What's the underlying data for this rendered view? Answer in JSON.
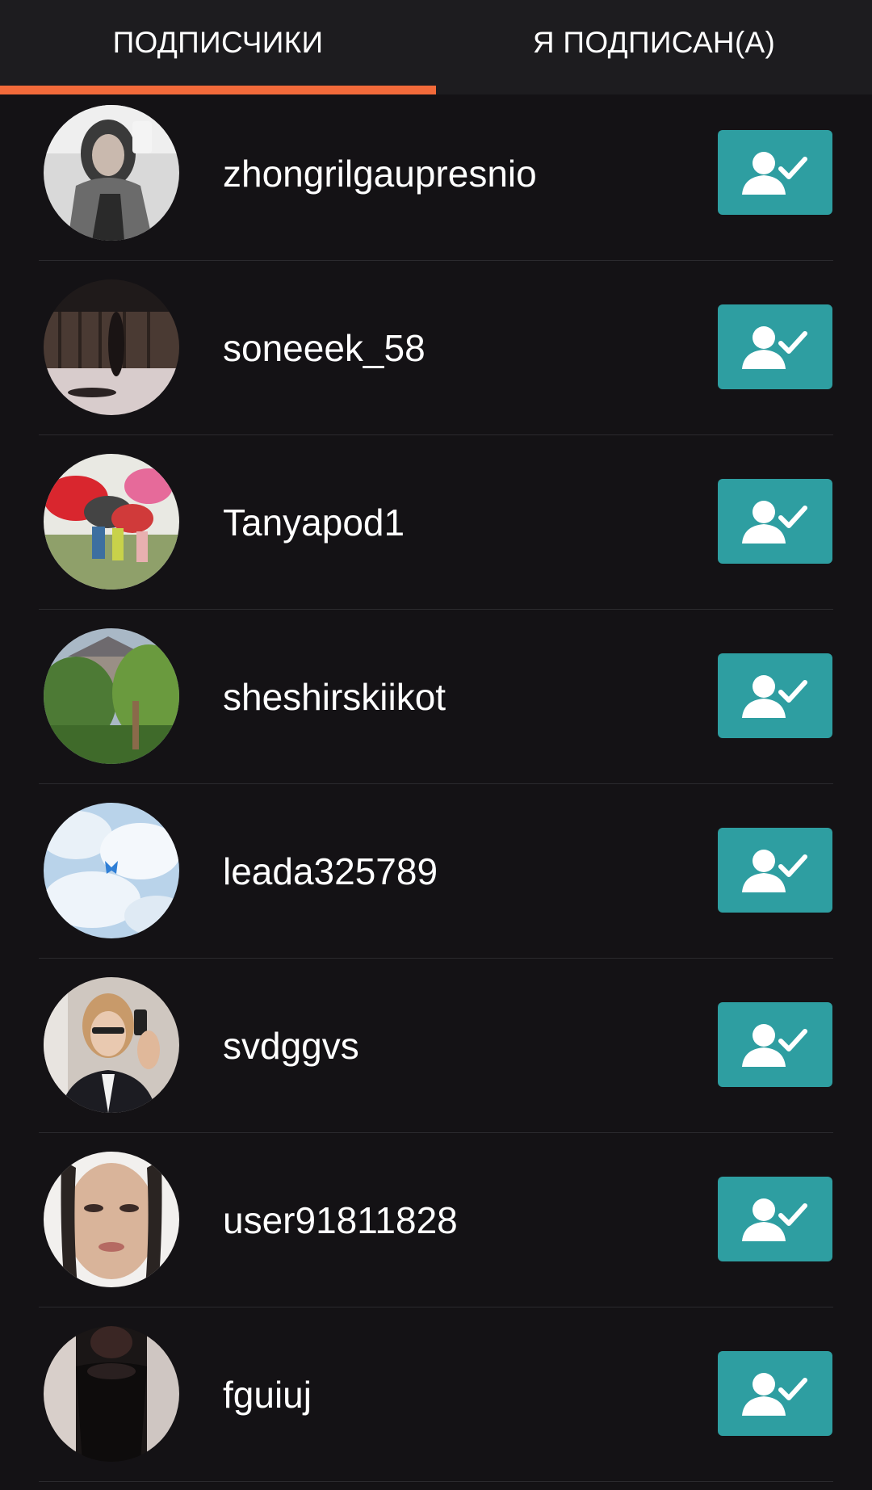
{
  "tabs": [
    {
      "label": "ПОДПИСЧИКИ",
      "active": true
    },
    {
      "label": "Я ПОДПИСАН(А)",
      "active": false
    }
  ],
  "colors": {
    "accent": "#f26a3a",
    "button": "#2e9ea1",
    "background": "#141215",
    "tabbar": "#1d1c1f"
  },
  "followers": [
    {
      "username": "zhongrilgaupresnio",
      "button_icon": "user-check-icon"
    },
    {
      "username": "soneeek_58",
      "button_icon": "user-check-icon"
    },
    {
      "username": "Tanyapod1",
      "button_icon": "user-check-icon"
    },
    {
      "username": "sheshirskiikot",
      "button_icon": "user-check-icon"
    },
    {
      "username": "leada325789",
      "button_icon": "user-check-icon"
    },
    {
      "username": "svdggvs",
      "button_icon": "user-check-icon"
    },
    {
      "username": "user91811828",
      "button_icon": "user-check-icon"
    },
    {
      "username": "fguiuj",
      "button_icon": "user-check-icon"
    }
  ]
}
